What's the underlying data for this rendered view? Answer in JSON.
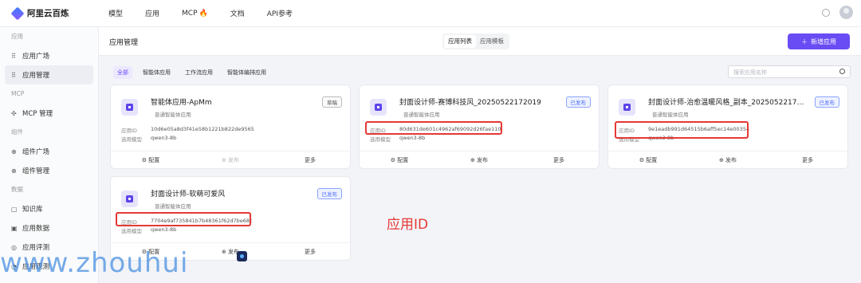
{
  "app": {
    "logo_text": "阿里云百炼"
  },
  "topnav": {
    "items": [
      "模型",
      "应用",
      "MCP",
      "文档",
      "API参考"
    ],
    "mcp_icon": "fire-icon"
  },
  "sidebar": {
    "groups": [
      {
        "label": "应用",
        "items": [
          {
            "label": "应用广场",
            "icon": "grid-icon"
          },
          {
            "label": "应用管理",
            "icon": "grid-icon",
            "active": true
          }
        ]
      },
      {
        "label": "MCP",
        "items": [
          {
            "label": "MCP 管理",
            "icon": "mcp-icon"
          }
        ]
      },
      {
        "label": "组件",
        "items": [
          {
            "label": "组件广场",
            "icon": "component-icon"
          },
          {
            "label": "组件管理",
            "icon": "component-icon"
          }
        ]
      },
      {
        "label": "数据",
        "items": [
          {
            "label": "知识库",
            "icon": "book-icon"
          },
          {
            "label": "应用数据",
            "icon": "chart-icon"
          },
          {
            "label": "应用评测",
            "icon": "eval-icon"
          },
          {
            "label": "应用观测",
            "icon": "observe-icon"
          }
        ]
      }
    ]
  },
  "header": {
    "title": "应用管理",
    "seg": [
      "应用列表",
      "应用模板"
    ],
    "add_button": "新增应用"
  },
  "filters": [
    "全部",
    "智能体应用",
    "工作流应用",
    "智能体编排应用"
  ],
  "search": {
    "placeholder": "搜索应用名称"
  },
  "card_labels": {
    "app_id": "应用ID",
    "model": "选用模型",
    "config": "配置",
    "publish": "发布",
    "more": "更多"
  },
  "cards": [
    {
      "title": "智能体应用-ApMm",
      "sub": "普通智能体应用",
      "status": "草稿",
      "app_id": "10d6e05a8d3f41e58b1221b822de9565",
      "model": "qwen3-8b"
    },
    {
      "title": "封面设计师-赛博科技风_20250522172019",
      "sub": "普通智能体应用",
      "status": "已发布",
      "app_id": "80d631de601c4962af69092d26fae110",
      "model": "qwen3-8b"
    },
    {
      "title": "封面设计师-治愈温暖风格_副本_202505221711...",
      "sub": "普通智能体应用",
      "status": "已发布",
      "app_id": "9e1eadb991d64515b6aff5ec14e00354",
      "model": "qwen3-8b"
    },
    {
      "title": "封面设计师-软萌可爱风",
      "sub": "普通智能体应用",
      "status": "已发布",
      "app_id": "7704e9af735841b7b48361f62d7be68c",
      "model": "qwen3-8b"
    }
  ],
  "annotation": {
    "label": "应用ID"
  },
  "watermark": {
    "text": "www.zhouhui"
  }
}
